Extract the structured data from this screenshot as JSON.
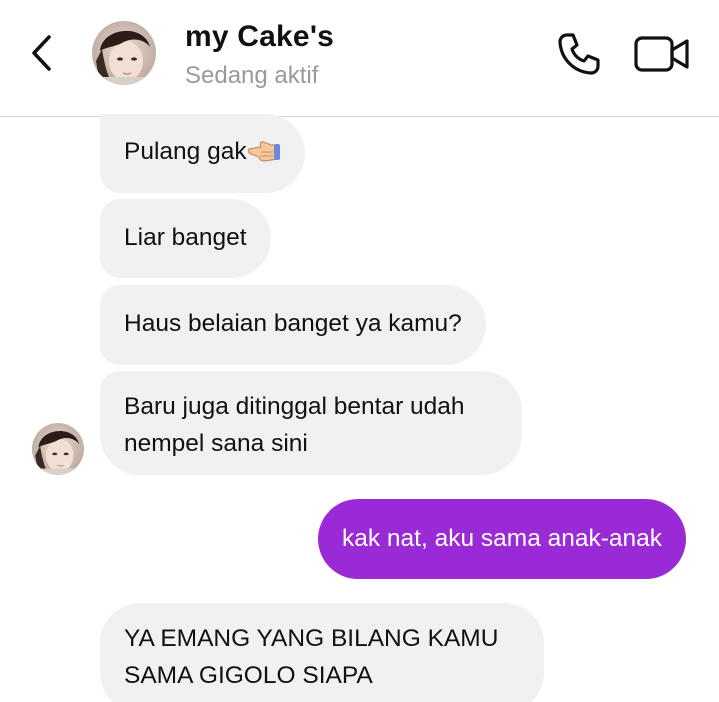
{
  "header": {
    "contact_name": "my Cake's",
    "status": "Sedang aktif",
    "back_icon": "chevron-left-icon",
    "call_icon": "phone-icon",
    "video_icon": "video-camera-icon"
  },
  "messages": [
    {
      "direction": "incoming",
      "text": "Pulang gak",
      "emoji": "pointing-finger-emoji"
    },
    {
      "direction": "incoming",
      "text": "Liar banget"
    },
    {
      "direction": "incoming",
      "text": "Haus belaian banget ya kamu?"
    },
    {
      "direction": "incoming",
      "lines": [
        "Baru juga ditinggal bentar udah",
        "nempel sana sini"
      ]
    },
    {
      "direction": "outgoing",
      "text": "kak nat, aku sama anak-anak"
    },
    {
      "direction": "incoming",
      "lines": [
        "YA EMANG YANG BILANG KAMU",
        "SAMA GIGOLO SIAPA"
      ]
    }
  ],
  "colors": {
    "outgoing_bubble": "#9a2ad6",
    "incoming_bubble": "#f1f1f3",
    "status_text": "#9a9a9a",
    "divider": "#d6d6d6"
  }
}
